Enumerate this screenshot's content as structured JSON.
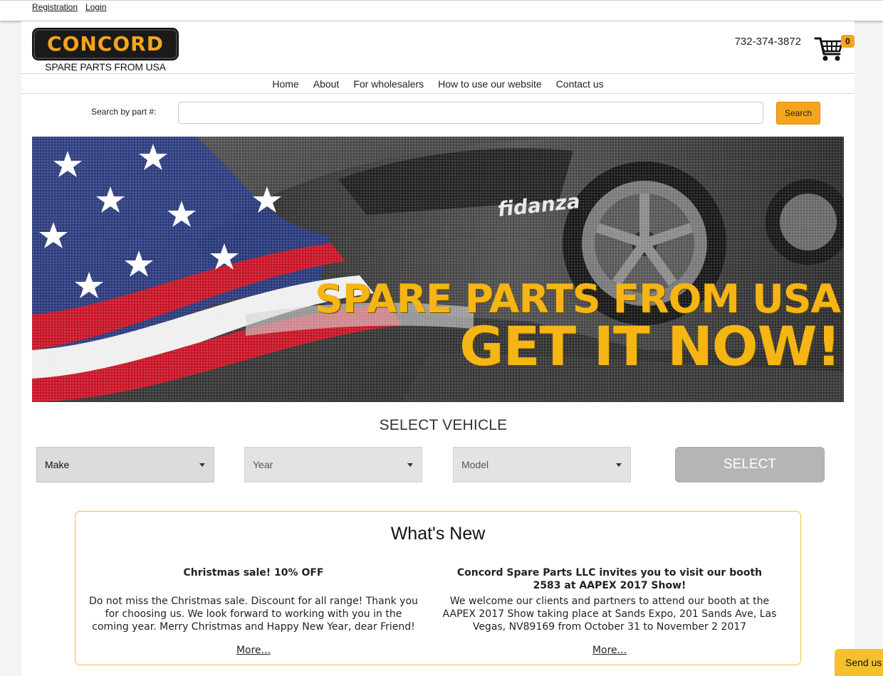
{
  "top_links": {
    "registration": "Registration",
    "login": "Login"
  },
  "header": {
    "logo_text": "CONCORD",
    "logo_sub": "SPARE PARTS FROM USA",
    "phone": "732-374-3872",
    "cart_count": "0"
  },
  "nav": {
    "items": [
      "Home",
      "About",
      "For wholesalers",
      "How to use our website",
      "Contact us"
    ]
  },
  "search": {
    "label": "Search by part #:",
    "value": "",
    "button": "Search"
  },
  "banner": {
    "brand": "fidanza",
    "line1": "SPARE PARTS FROM USA",
    "line2": "GET IT NOW!"
  },
  "vehicle": {
    "title": "SELECT VEHICLE",
    "make": "Make",
    "year": "Year",
    "model": "Model",
    "select_button": "SELECT"
  },
  "whats_new": {
    "title": "What's New",
    "news": [
      {
        "headline": "Christmas sale! 10% OFF",
        "body": "Do not miss the Christmas sale. Discount for all range! Thank you for choosing us. We look forward to working with you in the coming year. Merry Christmas and Happy New Year, dear Friend!",
        "more": "More..."
      },
      {
        "headline": "Concord Spare Parts LLC invites you to visit our booth 2583 at AAPEX 2017 Show!",
        "body": "We welcome our clients and partners to attend our booth at the AAPEX 2017 Show taking place at Sands Expo, 201 Sands Ave, Las Vegas, NV89169 from October 31 to November 2 2017",
        "more": "More..."
      }
    ]
  },
  "chat": {
    "label": "Send us"
  },
  "colors": {
    "accent": "#f5a51c",
    "border_gold": "#f0c232"
  }
}
